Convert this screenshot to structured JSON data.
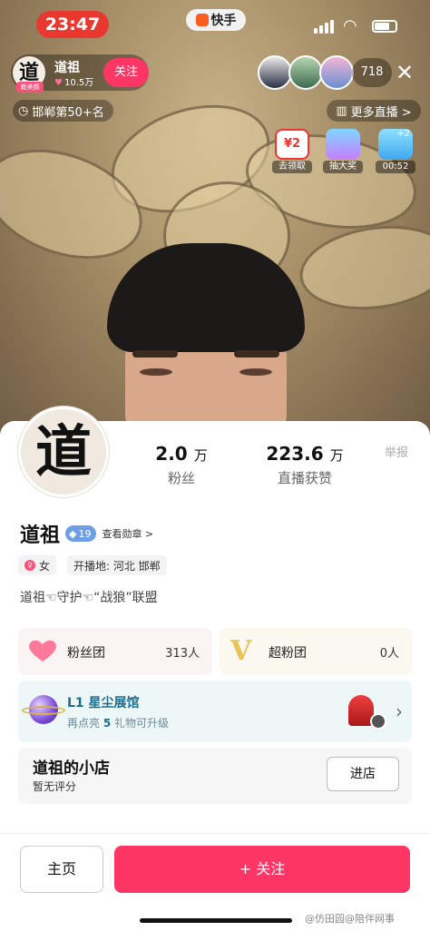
{
  "status_bar": {
    "time": "23:47",
    "app_brand": "快手"
  },
  "live_header": {
    "host_name": "道祖",
    "host_avatar_char": "道",
    "host_tag": "裁美颜",
    "host_likes": "10.5万",
    "follow_label": "关注",
    "viewer_count": "718",
    "rank_text": "邯郸第50+名",
    "more_live_label": "更多直播 >",
    "badges": [
      {
        "icon_text": "¥2",
        "label": "去领取"
      },
      {
        "icon_text": "",
        "label": "抽大奖"
      },
      {
        "icon_text": "+2",
        "label": "00:52"
      }
    ]
  },
  "profile": {
    "avatar_char": "道",
    "fans_count": "2.0",
    "fans_unit": "万",
    "fans_label": "粉丝",
    "likes_count": "223.6",
    "likes_unit": "万",
    "likes_label": "直播获赞",
    "report_label": "举报",
    "name": "道祖",
    "level": "19",
    "medals_label": "查看勋章 >",
    "gender_label": "女",
    "location_label": "开播地: 河北 邯郸",
    "signature": "道祖☜守护☜“战狼”联盟"
  },
  "cards": {
    "fans_club_title": "粉丝团",
    "fans_club_count": "313人",
    "super_fans_title": "超粉团",
    "super_fans_count": "0人",
    "hall_title": "L1 星尘展馆",
    "hall_sub_prefix": "再点亮",
    "hall_sub_num": "5",
    "hall_sub_suffix": "礼物可升级",
    "shop_title": "道祖的小店",
    "shop_sub": "暂无评分",
    "shop_button": "进店"
  },
  "bottom_bar": {
    "home_label": "主页",
    "follow_label": "+ 关注"
  },
  "watermark": "@仿田园@陪伴网事",
  "colors": {
    "accent": "#fe3666",
    "time_pill": "#e8382f",
    "hall_text": "#1b6e8e"
  }
}
